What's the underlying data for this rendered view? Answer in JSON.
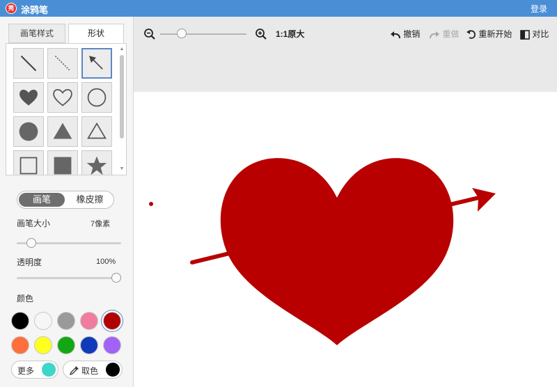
{
  "app": {
    "logo_char": "秀",
    "title": "涂鸦笔",
    "login_label": "登录"
  },
  "sidebar": {
    "tabs": [
      {
        "label": "画笔样式"
      },
      {
        "label": "形状"
      }
    ],
    "shapes": [
      {
        "icon": "line-solid-icon"
      },
      {
        "icon": "line-dashed-icon"
      },
      {
        "icon": "arrow-icon",
        "selected": true
      },
      {
        "icon": "heart-filled-icon"
      },
      {
        "icon": "heart-outline-icon"
      },
      {
        "icon": "circle-outline-icon"
      },
      {
        "icon": "circle-filled-icon"
      },
      {
        "icon": "triangle-filled-icon"
      },
      {
        "icon": "triangle-outline-icon"
      },
      {
        "icon": "square-outline-icon"
      },
      {
        "icon": "square-filled-icon"
      },
      {
        "icon": "star-filled-icon"
      }
    ],
    "mode": {
      "brush_label": "画笔",
      "eraser_label": "橡皮擦"
    },
    "brush_size": {
      "label": "画笔大小",
      "value": "7像素",
      "level": 0.1
    },
    "opacity": {
      "label": "透明度",
      "value": "100%",
      "level": 1.0
    },
    "colors": {
      "label": "颜色",
      "swatches": [
        "#000000",
        "#f6f6f6",
        "#9a9a9a",
        "#f07da0",
        "#b10000",
        "#ff6f3c",
        "#ffff22",
        "#13a813",
        "#0f3bbb",
        "#a263f5"
      ],
      "selected_index": 4,
      "more_label": "更多",
      "more_color": "#3dd6c8",
      "picker_label": "取色",
      "picker_color": "#000000"
    }
  },
  "toolbar": {
    "zoom_level": 0.22,
    "actual_size_label": "1:1原大",
    "undo_label": "撤销",
    "redo_label": "重做",
    "restart_label": "重新开始",
    "compare_label": "对比"
  },
  "canvas": {
    "background": "#ffffff",
    "drawing_color": "#b80000"
  }
}
